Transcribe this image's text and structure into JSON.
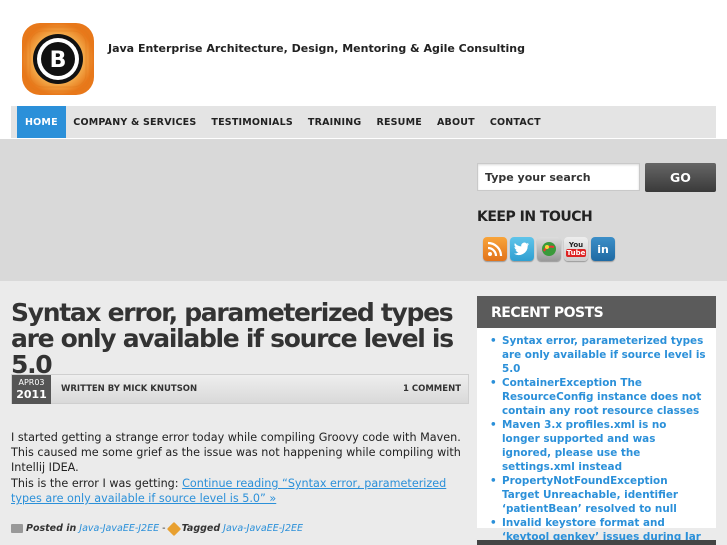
{
  "header": {
    "logo_letter": "B",
    "tagline": "Java Enterprise Architecture, Design, Mentoring & Agile Consulting"
  },
  "nav": {
    "items": [
      "HOME",
      "COMPANY & SERVICES",
      "TESTIMONIALS",
      "TRAINING",
      "RESUME",
      "ABOUT",
      "CONTACT"
    ],
    "active": "HOME"
  },
  "search": {
    "placeholder": "Type your search",
    "button_label": "GO"
  },
  "keep_in_touch": {
    "title": "KEEP IN TOUCH",
    "icons": [
      "rss-icon",
      "twitter-icon",
      "delicious-icon",
      "youtube-icon",
      "linkedin-icon"
    ],
    "youtube_label_top": "You",
    "youtube_label_bottom": "Tube",
    "linkedin_label": "in"
  },
  "post": {
    "title": "Syntax error, parameterized types are only available if source level is 5.0",
    "month_day": "APR03",
    "year": "2011",
    "written_by": "WRITTEN BY MICK KNUTSON",
    "comments": "1 COMMENT",
    "paragraph1": "I started getting a strange error today while compiling Groovy code with Maven. This caused me some grief as the issue was not happening while compiling with Intellij IDEA.",
    "paragraph2_prefix": "This is the error I was getting: ",
    "continue_link": "Continue reading “Syntax error, parameterized types are only available if source level is 5.0” »",
    "posted_in_label": "Posted in",
    "category": "Java-JavaEE-J2EE",
    "separator": "-",
    "tagged_label": "Tagged",
    "tag": "Java-JavaEE-J2EE"
  },
  "recent_posts": {
    "title": "RECENT POSTS",
    "items": [
      "Syntax error, parameterized types are only available if source level is 5.0",
      "ContainerException The ResourceConfig instance does not contain any root resource classes",
      "Maven 3.x profiles.xml is no longer supported and was ignored, please use the settings.xml instead",
      "PropertyNotFoundException Target Unreachable, identifier ‘patientBean’ resolved to null",
      "Invalid keystore format and ‘keytool genkey’ issues during Jar signing"
    ]
  },
  "colors": {
    "accent": "#2b90d9",
    "logo_orange": "#f08a24",
    "dark_widget": "#5b5b5b"
  }
}
